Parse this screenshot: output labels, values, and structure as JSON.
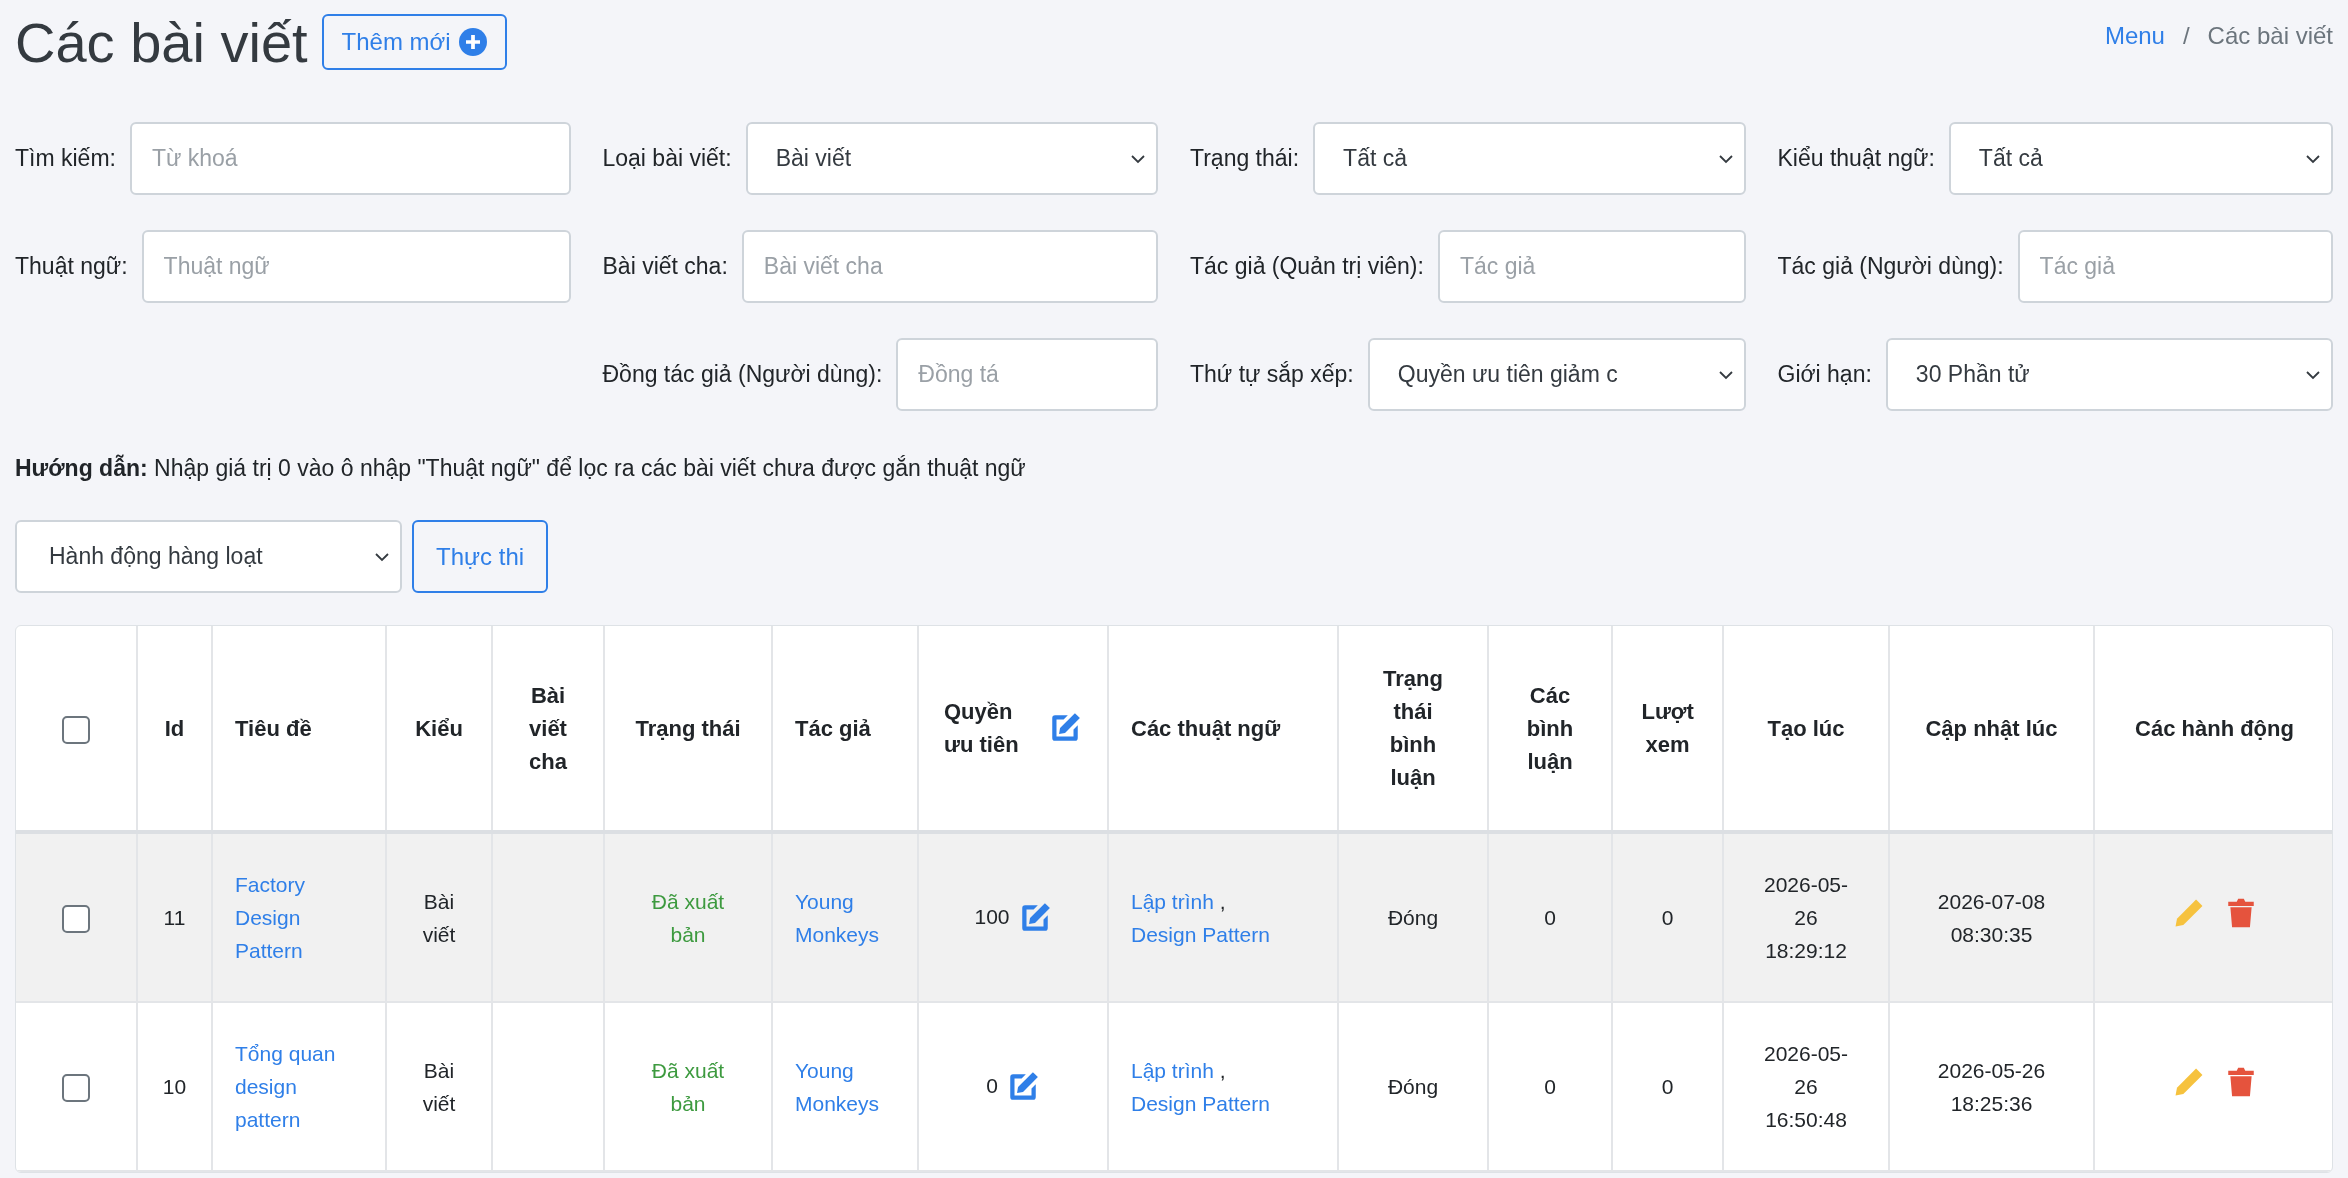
{
  "header": {
    "title": "Các bài viết",
    "add_button": "Thêm mới"
  },
  "breadcrumb": {
    "separator": "/",
    "items": [
      {
        "label": "Menu",
        "kind": "link"
      },
      {
        "label": "Các bài viết",
        "kind": "current"
      }
    ]
  },
  "filter_rows": [
    [
      {
        "label": "Tìm kiếm:",
        "kind": "input",
        "placeholder": "Từ khoá"
      },
      {
        "label": "Loại bài viết:",
        "kind": "select",
        "value": "Bài viết"
      },
      {
        "label": "Trạng thái:",
        "kind": "select",
        "value": "Tất cả"
      },
      {
        "label": "Kiểu thuật ngữ:",
        "kind": "select",
        "value": "Tất cả"
      }
    ],
    [
      {
        "label": "Thuật ngữ:",
        "kind": "input",
        "placeholder": "Thuật ngữ"
      },
      {
        "label": "Bài viết cha:",
        "kind": "input",
        "placeholder": "Bài viết cha"
      },
      {
        "label": "Tác giả (Quản trị viên):",
        "kind": "input",
        "placeholder": "Tác giả"
      },
      {
        "label": "Tác giả (Người dùng):",
        "kind": "input",
        "placeholder": "Tác giả"
      }
    ],
    [
      {
        "label": "Đồng tác giả (Người dùng):",
        "kind": "input",
        "placeholder": "Đồng tá"
      },
      {
        "label": "Thứ tự sắp xếp:",
        "kind": "select",
        "value": "Quyền ưu tiên giảm c"
      },
      {
        "label": "Giới hạn:",
        "kind": "select",
        "value": "30 Phần tử"
      }
    ]
  ],
  "hint": "**Hướng dẫn:** Nhập giá trị 0 vào ô nhập \"Thuật ngữ\" để lọc ra các bài viết chưa được gắn thuật ngữ",
  "bulk": {
    "select": "Hành động hàng loạt",
    "button": "Thực thi"
  },
  "table": {
    "select_all": {
      "checked": false
    },
    "columns": [
      {
        "kind": "checkbox"
      },
      {
        "label": "Id",
        "kind": "text"
      },
      {
        "label": "Tiêu đề",
        "kind": "text"
      },
      {
        "label": "Kiểu",
        "kind": "text"
      },
      {
        "label": "Bài viết cha",
        "kind": "text"
      },
      {
        "label": "Trạng thái",
        "kind": "text"
      },
      {
        "label": "Tác giả",
        "kind": "text"
      },
      {
        "label": "Quyền ưu tiên",
        "kind": "editable"
      },
      {
        "label": "Các thuật ngữ",
        "kind": "text"
      },
      {
        "label": "Trạng thái bình luận",
        "kind": "text"
      },
      {
        "label": "Các bình luận",
        "kind": "text"
      },
      {
        "label": "Lượt xem",
        "kind": "text"
      },
      {
        "label": "Tạo lúc",
        "kind": "text"
      },
      {
        "label": "Cập nhật lúc",
        "kind": "text"
      },
      {
        "label": "Các hành động",
        "kind": "text"
      }
    ],
    "rows": [
      {
        "checked": false,
        "id": "11",
        "title": "Factory Design Pattern",
        "type": "Bài viết",
        "status": "Đã xuất bản",
        "author": "Young Monkeys",
        "priority": "100",
        "terms": [
          {
            "label": "Lập trình",
            "separator": ","
          },
          {
            "label": "Design Pattern"
          }
        ],
        "comment_status": "Đóng",
        "comments": "0",
        "views": "0",
        "created": "2026-05-26 18:29:12",
        "updated": "2026-07-08 08:30:35"
      },
      {
        "checked": false,
        "id": "10",
        "title": "Tổng quan design pattern",
        "type": "Bài viết",
        "status": "Đã xuất bản",
        "author": "Young Monkeys",
        "priority": "0",
        "terms": [
          {
            "label": "Lập trình",
            "separator": ","
          },
          {
            "label": "Design Pattern"
          }
        ],
        "comment_status": "Đóng",
        "comments": "0",
        "views": "0",
        "created": "2026-05-26 16:50:48",
        "updated": "2026-05-26 18:25:36"
      }
    ]
  }
}
